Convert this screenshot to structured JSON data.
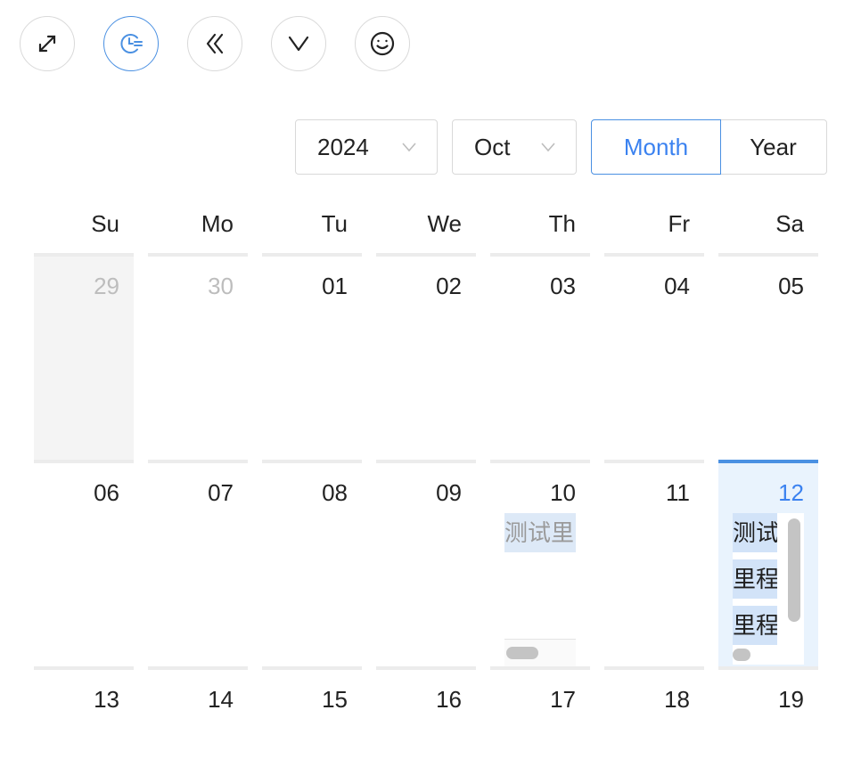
{
  "toolbar": {
    "buttons": [
      {
        "icon": "expand-icon"
      },
      {
        "icon": "clock-list-icon"
      },
      {
        "icon": "double-chevron-left-icon"
      },
      {
        "icon": "chevron-down-icon"
      },
      {
        "icon": "smile-icon"
      }
    ]
  },
  "header": {
    "year": "2024",
    "month": "Oct",
    "mode_month": "Month",
    "mode_year": "Year"
  },
  "weekdays": [
    "Su",
    "Mo",
    "Tu",
    "We",
    "Th",
    "Fr",
    "Sa"
  ],
  "weeks": [
    [
      "29",
      "30",
      "01",
      "02",
      "03",
      "04",
      "05"
    ],
    [
      "06",
      "07",
      "08",
      "09",
      "10",
      "11",
      "12"
    ],
    [
      "13",
      "14",
      "15",
      "16",
      "17",
      "18",
      "19"
    ]
  ],
  "events": {
    "oct10": [
      "测试里"
    ],
    "oct12": [
      "测试",
      "里程",
      "里程"
    ]
  },
  "colors": {
    "accent": "#3b82f0",
    "today_bg": "#e9f3fd",
    "event_bg": "#d2e3f8"
  }
}
